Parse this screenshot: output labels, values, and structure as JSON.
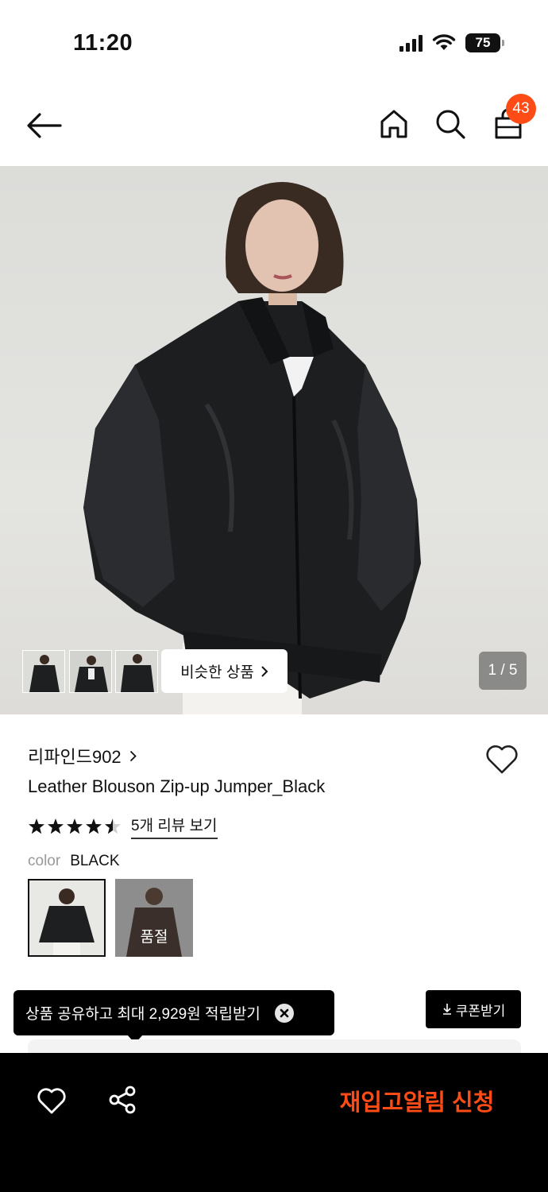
{
  "status_bar": {
    "time": "11:20",
    "battery": "75"
  },
  "nav": {
    "icons": [
      "back-arrow-icon",
      "home-icon",
      "search-icon",
      "shopping-bag-icon"
    ],
    "cart_count": "43"
  },
  "hero": {
    "similar_label": "비슷한 상품",
    "page_indicator": "1 / 5"
  },
  "product": {
    "brand": "리파인드902",
    "name": "Leather Blouson Zip-up Jumper_Black",
    "rating": 4.5,
    "review_link": "5개 리뷰 보기",
    "color_label": "color",
    "color_value": "BLACK",
    "soldout_label": "품절"
  },
  "share_tooltip": {
    "text": "상품 공유하고 최대 2,929원 적립받기"
  },
  "coupon_button": {
    "label": "쿠폰받기"
  },
  "bottom_bar": {
    "restock_label": "재입고알림 신청"
  },
  "colors": {
    "accent": "#ff4c16",
    "dark": "#000000"
  }
}
